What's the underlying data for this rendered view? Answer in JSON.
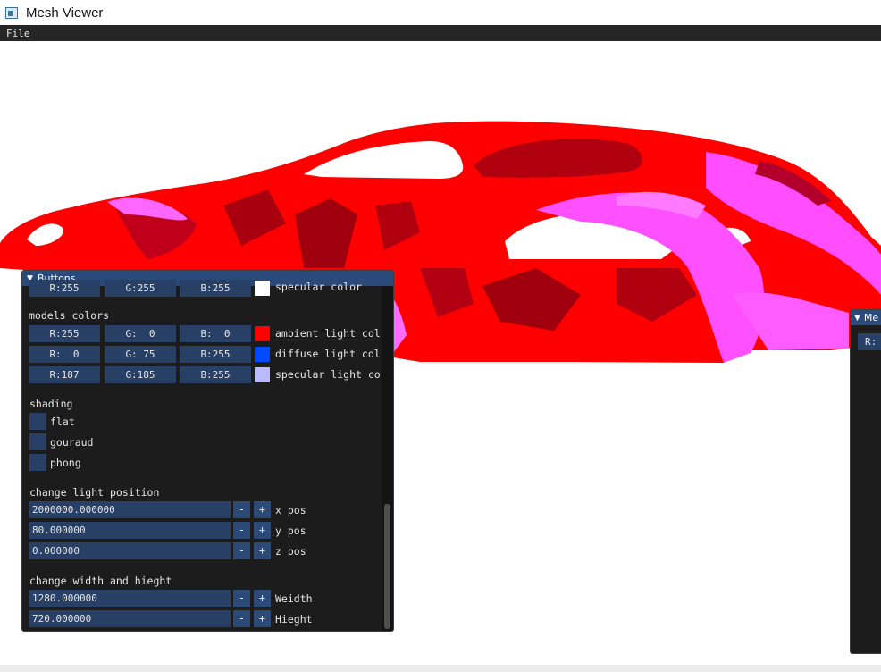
{
  "window": {
    "title": "Mesh Viewer"
  },
  "menubar": {
    "items": [
      "File"
    ]
  },
  "model": {
    "color": "#ff0000",
    "highlight_color": "#ff5cff",
    "shadow_color": "#8a0010"
  },
  "buttons_panel": {
    "title": "Buttons",
    "top_row": {
      "r": "R:255",
      "g": "G:255",
      "b": "B:255",
      "label": "specular color",
      "swatch": "#ffffff"
    },
    "models_colors": {
      "header": "models colors",
      "rows": [
        {
          "r": "R:255",
          "g": "G:  0",
          "b": "B:  0",
          "swatch": "#ff0000",
          "label": "ambient light col"
        },
        {
          "r": "R:  0",
          "g": "G: 75",
          "b": "B:255",
          "swatch": "#004bff",
          "label": "diffuse light col"
        },
        {
          "r": "R:187",
          "g": "G:185",
          "b": "B:255",
          "swatch": "#bbb9ff",
          "label": "specular light co"
        }
      ]
    },
    "shading": {
      "header": "shading",
      "options": [
        {
          "label": "flat"
        },
        {
          "label": "gouraud"
        },
        {
          "label": "phong"
        }
      ]
    },
    "light_position": {
      "header": "change light position",
      "fields": [
        {
          "value": "2000000.000000",
          "label": "x pos"
        },
        {
          "value": "80.000000",
          "label": "y pos"
        },
        {
          "value": "0.000000",
          "label": "z pos"
        }
      ]
    },
    "size": {
      "header": "change width and hieght",
      "fields": [
        {
          "value": "1280.000000",
          "label": "Weidth"
        },
        {
          "value": "720.000000",
          "label": "Hieght"
        }
      ]
    },
    "minus_label": "-",
    "plus_label": "+"
  },
  "second_panel": {
    "title": "Me",
    "field": "R:"
  }
}
